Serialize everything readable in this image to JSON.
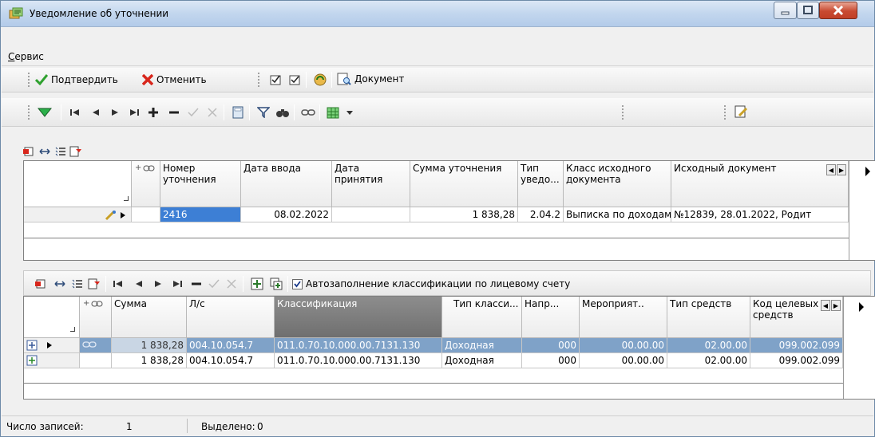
{
  "window": {
    "title": "Уведомление об уточнении"
  },
  "menu": {
    "items": [
      "Сервис"
    ]
  },
  "toolbar1": {
    "confirm_label": "Подтвердить",
    "cancel_label": "Отменить",
    "document_label": "Документ"
  },
  "upper_grid": {
    "headers": [
      "Номер уточнения",
      "Дата ввода",
      "Дата принятия",
      "Сумма уточнения",
      "Тип уведо...",
      "Класс исходного документа",
      "Исходный документ"
    ],
    "row": [
      "2416",
      "08.02.2022",
      "",
      "1 838,28",
      "2.04.2",
      "Выписка по доходам",
      "№12839, 28.01.2022, Родит"
    ]
  },
  "lower_toolbar": {
    "autofill_label": "Автозаполнение классификации по лицевому счету",
    "autofill_checked": true
  },
  "lower_grid": {
    "headers": [
      "Сумма",
      "Л/с",
      "Классификация",
      "Тип класси...",
      "Напр...",
      "Мероприят..",
      "Тип средств",
      "Код целевых средств"
    ],
    "rows": [
      [
        "1 838,28",
        "004.10.054.7",
        "011.0.70.10.000.00.7131.130",
        "Доходная",
        "000",
        "00.00.00",
        "02.00.00",
        "099.002.099"
      ],
      [
        "1 838,28",
        "004.10.054.7",
        "011.0.70.10.000.00.7131.130",
        "Доходная",
        "000",
        "00.00.00",
        "02.00.00",
        "099.002.099"
      ]
    ]
  },
  "status": {
    "count_label": "Число записей:",
    "count_value": "1",
    "selected_label": "Выделено:",
    "selected_value": "0"
  },
  "colors": {
    "selection": "#7fa2c8",
    "confirm_green": "#2fa12f",
    "cancel_red": "#d8261c"
  }
}
